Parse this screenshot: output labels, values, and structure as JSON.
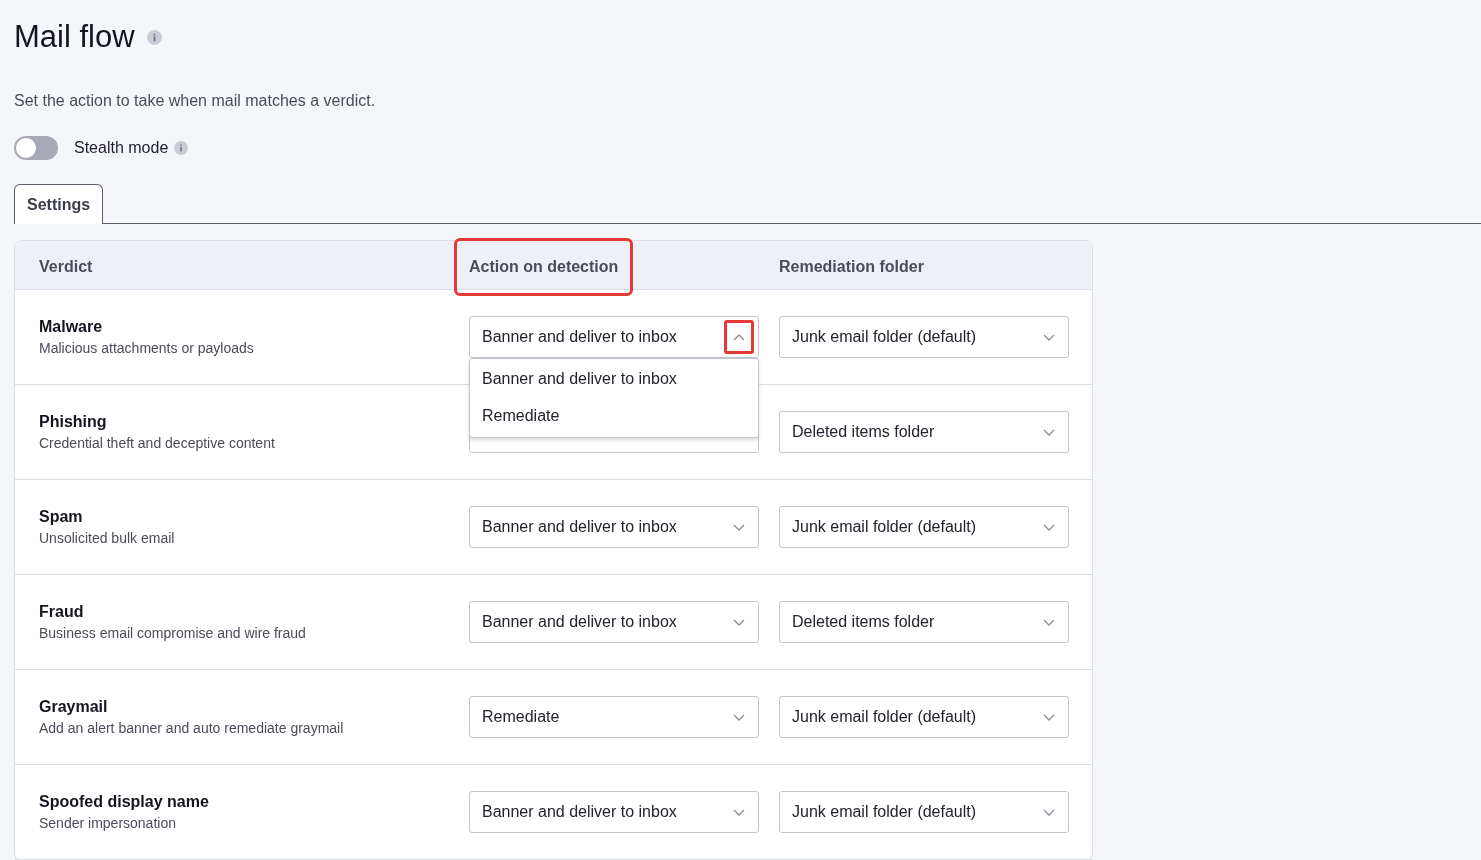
{
  "page": {
    "title": "Mail flow",
    "description": "Set the action to take when mail matches a verdict."
  },
  "stealth_mode": {
    "label": "Stealth mode",
    "on": false
  },
  "tabs": [
    {
      "label": "Settings",
      "selected": true
    }
  ],
  "table": {
    "columns": [
      {
        "label": "Verdict",
        "highlighted": false
      },
      {
        "label": "Action on detection",
        "highlighted": true
      },
      {
        "label": "Remediation folder",
        "highlighted": false
      }
    ],
    "rows": [
      {
        "name": "Malware",
        "description": "Malicious attachments or payloads",
        "action": {
          "value": "Banner and deliver to inbox",
          "expanded": true,
          "caret_highlighted": true,
          "options": [
            "Banner and deliver to inbox",
            "Remediate"
          ]
        },
        "folder": {
          "value": "Junk email folder (default)"
        }
      },
      {
        "name": "Phishing",
        "description": "Credential theft and deceptive content",
        "action": {},
        "folder": {
          "value": "Deleted items folder"
        }
      },
      {
        "name": "Spam",
        "description": "Unsolicited bulk email",
        "action": {
          "value": "Banner and deliver to inbox",
          "expanded": false
        },
        "folder": {
          "value": "Junk email folder (default)"
        }
      },
      {
        "name": "Fraud",
        "description": "Business email compromise and wire fraud",
        "action": {
          "value": "Banner and deliver to inbox",
          "expanded": false
        },
        "folder": {
          "value": "Deleted items folder"
        }
      },
      {
        "name": "Graymail",
        "description": "Add an alert banner and auto remediate graymail",
        "action": {
          "value": "Remediate",
          "expanded": false
        },
        "folder": {
          "value": "Junk email folder (default)"
        }
      },
      {
        "name": "Spoofed display name",
        "description": "Sender impersonation",
        "action": {
          "value": "Banner and deliver to inbox",
          "expanded": false
        },
        "folder": {
          "value": "Junk email folder (default)"
        }
      }
    ]
  }
}
